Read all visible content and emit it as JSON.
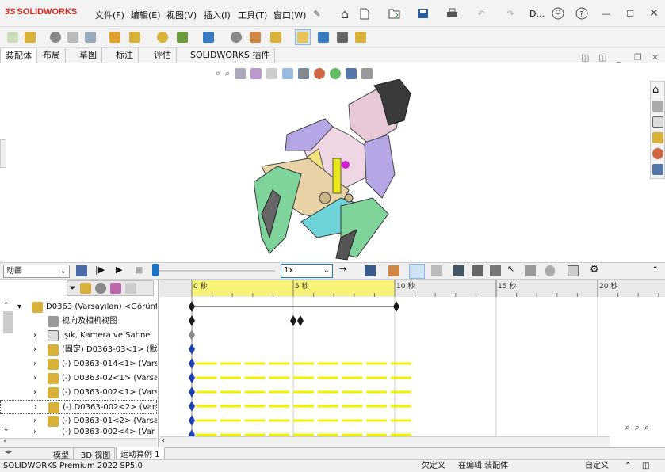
{
  "app": {
    "logo_text": "SOLIDWORKS",
    "logo_mark": "3S"
  },
  "menu": [
    "文件(F)",
    "编辑(E)",
    "视图(V)",
    "插入(I)",
    "工具(T)",
    "窗口(W)"
  ],
  "quick_access": {
    "user_label": "D..."
  },
  "command_tabs": [
    "装配体",
    "布局",
    "草图",
    "标注",
    "评估",
    "SOLIDWORKS 插件"
  ],
  "motion": {
    "study_type": "动画",
    "speed": "1x"
  },
  "tree": [
    {
      "text": "D0363 (Varsayılan) <Görüntü",
      "expander": "▾"
    },
    {
      "text": "视向及相机视图",
      "expander": ""
    },
    {
      "text": "Işık, Kamera ve Sahne",
      "expander": "›"
    },
    {
      "text": "(固定) D0363-03<1> (默认",
      "expander": "›"
    },
    {
      "text": "(-) D0363-014<1> (Varsa",
      "expander": "›"
    },
    {
      "text": "(-) D0363-02<1> (Varsay",
      "expander": "›"
    },
    {
      "text": "(-) D0363-002<1> (Varsa",
      "expander": "›"
    },
    {
      "text": "(-) D0363-002<2> (Varsa",
      "expander": "›"
    },
    {
      "text": "(-) D0363-01<2> (Varsay",
      "expander": "›"
    },
    {
      "text": "(-) D0363-002<4> (Var",
      "expander": "›"
    }
  ],
  "timeline": {
    "ticks": [
      {
        "label": "0 秒",
        "t": 0
      },
      {
        "label": "5 秒",
        "t": 5
      },
      {
        "label": "10 秒",
        "t": 10
      },
      {
        "label": "15 秒",
        "t": 15
      },
      {
        "label": "20 秒",
        "t": 20
      }
    ],
    "duration": 10
  },
  "bottom_tabs": [
    "模型",
    "3D 视图",
    "运动算例 1"
  ],
  "status": {
    "product": "SOLIDWORKS Premium 2022 SP5.0",
    "state1": "欠定义",
    "state2": "在编辑 装配体",
    "units": "自定义"
  },
  "colors": {
    "accent": "#0078d7",
    "logo": "#d52b1e",
    "keyframe": "#1a1a1a",
    "bar": "#f2f200",
    "blue_diamond": "#1c3fb5"
  }
}
